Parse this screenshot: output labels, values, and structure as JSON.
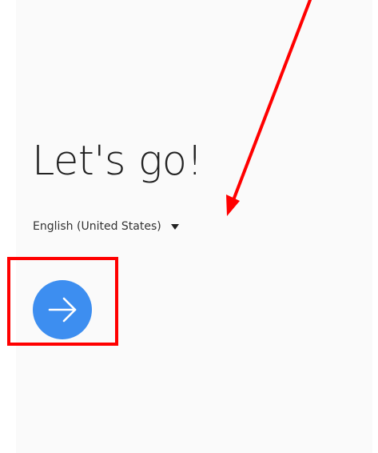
{
  "welcome": {
    "title": "Let's go!",
    "language_selected": "English (United States)",
    "next_button_icon": "arrow-right-icon",
    "caret_icon": "dropdown-caret-icon"
  },
  "colors": {
    "accent": "#3d8ef0",
    "annotation": "#ff0000",
    "background": "#fafafa"
  },
  "annotations": {
    "arrow_icon": "annotation-arrow",
    "highlight_box": "annotation-highlight-box"
  }
}
